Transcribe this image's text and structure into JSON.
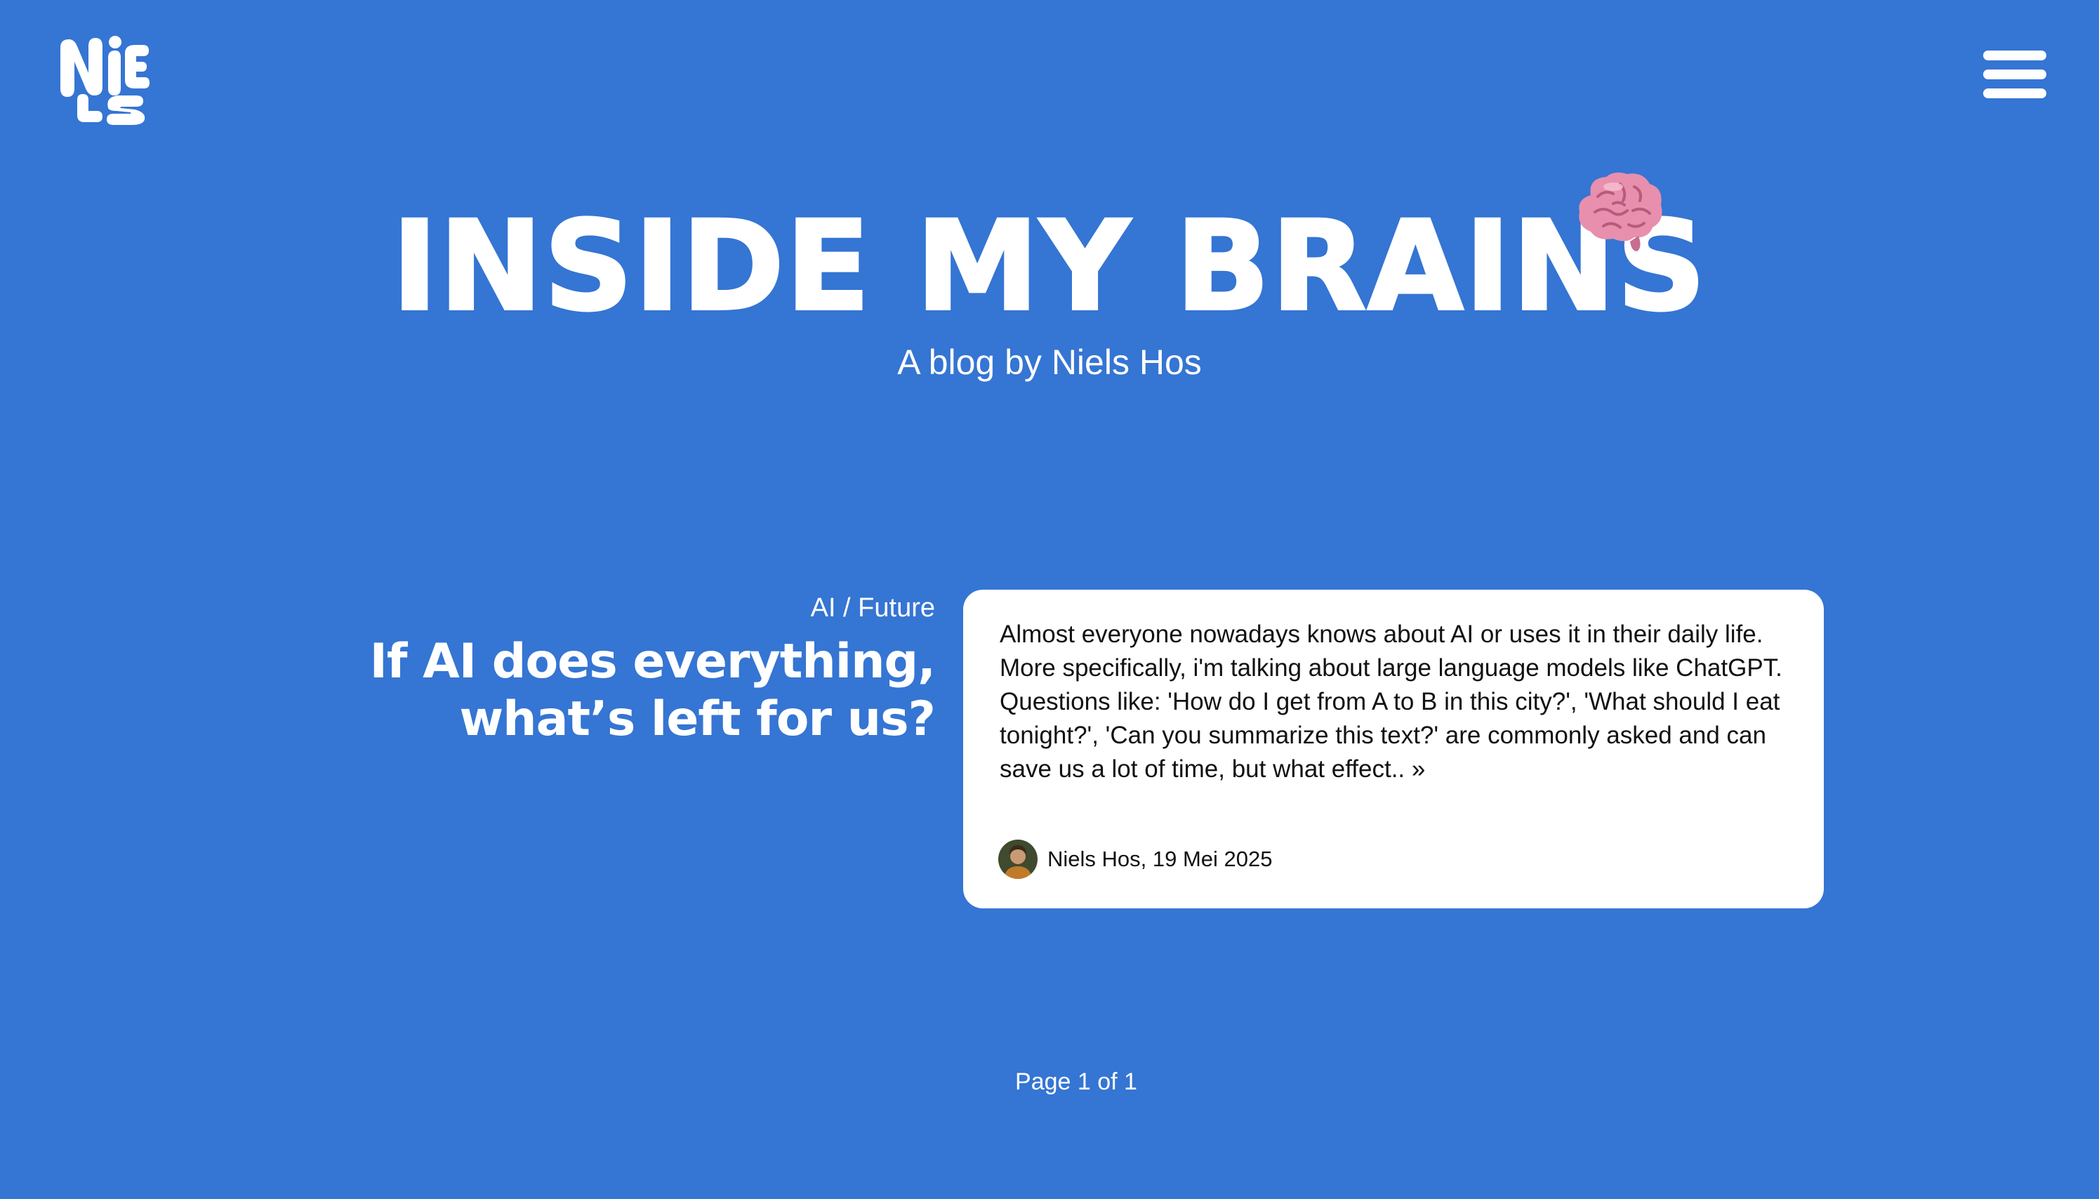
{
  "colors": {
    "background": "#3575d3",
    "text": "#ffffff",
    "card_background": "#ffffff",
    "card_text": "#111111",
    "brain_pink": "#e88fae"
  },
  "header": {
    "logo_icon": "niels-logo",
    "menu_icon": "hamburger-menu-icon"
  },
  "hero": {
    "title": "INSIDE MY BRAINS",
    "subtitle": "A blog by Niels Hos",
    "decoration_icon": "brain-icon"
  },
  "posts": [
    {
      "category": "AI / Future",
      "title_line1": "If AI does everything,",
      "title_line2": "what’s left for us?",
      "excerpt": "Almost everyone nowadays knows about AI or uses it in their daily life. More specifically, i'm talking about large language models like ChatGPT. Questions like: 'How do I get from A to B in this city?', 'What should I eat tonight?', 'Can you summarize this text?' are commonly asked and can save us a lot of time, but what effect.. »",
      "byline": "Niels Hos, 19 Mei 2025"
    }
  ],
  "pagination": {
    "label": "Page 1 of 1"
  }
}
